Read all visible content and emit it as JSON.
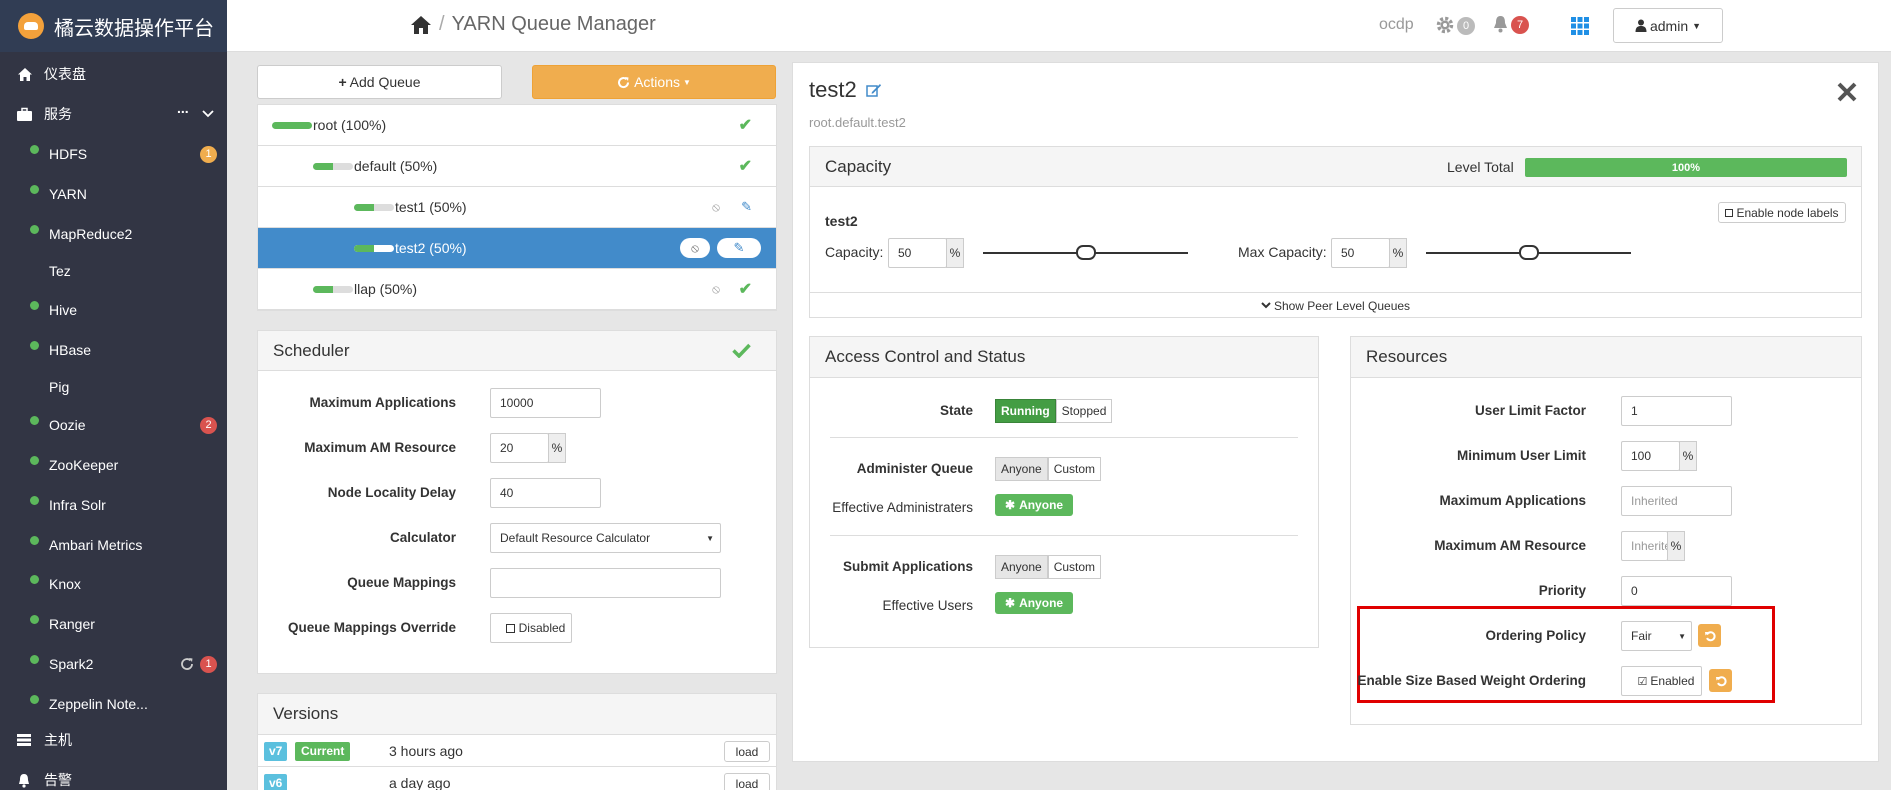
{
  "sidebar": {
    "brand": "橘云数据操作平台",
    "dashboard": "仪表盘",
    "services": "服务",
    "services_more": "...",
    "items": [
      {
        "label": "HDFS",
        "dot": true,
        "badge": "1",
        "badge_color": "#f0ad4e"
      },
      {
        "label": "YARN",
        "dot": true
      },
      {
        "label": "MapReduce2",
        "dot": true
      },
      {
        "label": "Tez",
        "dot": false
      },
      {
        "label": "Hive",
        "dot": true
      },
      {
        "label": "HBase",
        "dot": true
      },
      {
        "label": "Pig",
        "dot": false
      },
      {
        "label": "Oozie",
        "dot": true,
        "badge": "2",
        "badge_color": "#d9534f"
      },
      {
        "label": "ZooKeeper",
        "dot": true
      },
      {
        "label": "Infra Solr",
        "dot": true
      },
      {
        "label": "Ambari Metrics",
        "dot": true
      },
      {
        "label": "Knox",
        "dot": true
      },
      {
        "label": "Ranger",
        "dot": true
      },
      {
        "label": "Spark2",
        "dot": true,
        "badge": "1",
        "badge_color": "#d9534f",
        "refresh": true
      },
      {
        "label": "Zeppelin Note...",
        "dot": true
      }
    ],
    "hosts": "主机",
    "alerts": "告警"
  },
  "topbar": {
    "title": "YARN Queue Manager",
    "cluster": "ocdp",
    "ops_count": "0",
    "alerts_count": "7",
    "user": "admin"
  },
  "left": {
    "add_queue": "Add Queue",
    "actions": "Actions",
    "queues": [
      {
        "label": "root (100%)",
        "fill": 1.0,
        "selected": false,
        "status": "check"
      },
      {
        "label": "default (50%)",
        "fill": 0.5,
        "selected": false,
        "status": "check"
      },
      {
        "label": "test1 (50%)",
        "fill": 0.5,
        "selected": false,
        "status": "edit"
      },
      {
        "label": "test2 (50%)",
        "fill": 0.5,
        "selected": true,
        "status": "edit"
      },
      {
        "label": "llap (50%)",
        "fill": 0.5,
        "selected": false,
        "status": "check"
      }
    ],
    "scheduler": {
      "title": "Scheduler",
      "max_apps_label": "Maximum Applications",
      "max_apps_value": "10000",
      "max_am_label": "Maximum AM Resource",
      "max_am_value": "20",
      "percent": "%",
      "locality_label": "Node Locality Delay",
      "locality_value": "40",
      "calculator_label": "Calculator",
      "calculator_value": "Default Resource Calculator",
      "mappings_label": "Queue Mappings",
      "mappings_value": "",
      "override_label": "Queue Mappings Override",
      "override_value": "Disabled"
    },
    "versions": {
      "title": "Versions",
      "rows": [
        {
          "tag": "v7",
          "current": "Current",
          "time": "3 hours ago",
          "action": "load"
        },
        {
          "tag": "v6",
          "current": "",
          "time": "a day ago",
          "action": "load"
        }
      ]
    }
  },
  "queue": {
    "name": "test2",
    "path": "root.default.test2",
    "capacity": {
      "title": "Capacity",
      "level_total_label": "Level Total",
      "level_total_value": "100%",
      "level_total_fill": 1.0,
      "enable_node_labels": "Enable node labels",
      "queue_label": "test2",
      "capacity_label": "Capacity:",
      "capacity_value": "50",
      "max_capacity_label": "Max Capacity:",
      "max_capacity_value": "50",
      "capacity_level": 0.5,
      "max_capacity_level": 0.5,
      "percent": "%",
      "peer_toggle": "Show Peer Level Queues"
    },
    "access": {
      "title": "Access Control and Status",
      "state_label": "State",
      "state_running": "Running",
      "state_stopped": "Stopped",
      "administer_label": "Administer Queue",
      "anyone": "Anyone",
      "custom": "Custom",
      "effective_admins_label": "Effective Administraters",
      "effective_admins_value": "Anyone",
      "submit_label": "Submit Applications",
      "effective_users_label": "Effective Users",
      "effective_users_value": "Anyone"
    },
    "resources": {
      "title": "Resources",
      "ulf_label": "User Limit Factor",
      "ulf_value": "1",
      "mul_label": "Minimum User Limit",
      "mul_value": "100",
      "percent": "%",
      "max_apps_label": "Maximum Applications",
      "max_apps_placeholder": "Inherited",
      "max_am_label": "Maximum AM Resource",
      "max_am_placeholder": "Inherite",
      "priority_label": "Priority",
      "priority_value": "0",
      "ordering_label": "Ordering Policy",
      "ordering_value": "Fair",
      "size_label": "Enable Size Based Weight Ordering",
      "size_value": "Enabled"
    }
  },
  "colors": {
    "sidebar": "#323544",
    "accent": "#f0ad4e",
    "selected": "#428bca",
    "success": "#5cb85c",
    "highlight": "#e00000"
  }
}
